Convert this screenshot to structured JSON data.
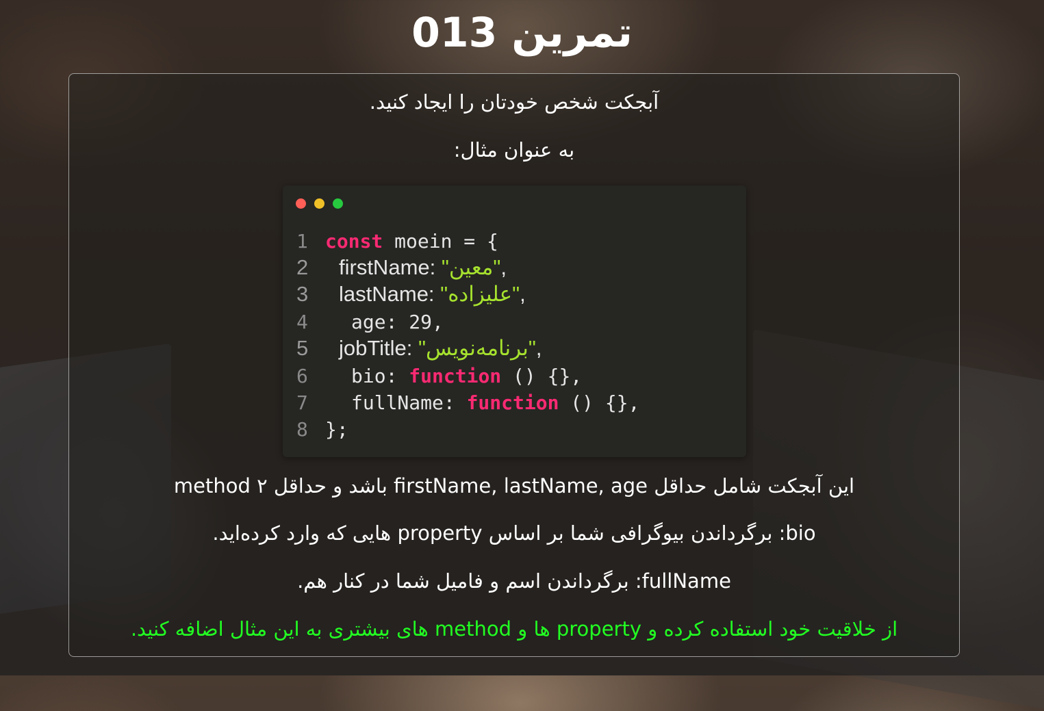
{
  "title": "تمرین 013",
  "card": {
    "intro": "آبجکت شخص خودتان را ایجاد کنید.",
    "example_label": "به عنوان مثال:",
    "requirement": "این آبجکت شامل حداقل firstName, lastName, age باشد و حداقل ۲ method",
    "bio_desc": "bio: برگرداندن بیوگرافی شما بر اساس property هایی که وارد کرده‌اید.",
    "fullname_desc": "fullName: برگرداندن اسم و فامیل شما در کنار هم.",
    "creativity_note": "از خلاقیت خود استفاده کرده و property ها و method های بیشتری به این مثال اضافه کنید."
  },
  "code": {
    "window_buttons": [
      "close",
      "minimize",
      "maximize"
    ],
    "lines": [
      {
        "num": "1",
        "kw": "const",
        "text": " moein = {"
      },
      {
        "num": "2",
        "key": "firstName: ",
        "value": "\"معین\"",
        "tail": ","
      },
      {
        "num": "3",
        "key": "lastName: ",
        "value": "\"علیزاده\"",
        "tail": ","
      },
      {
        "num": "4",
        "text": "age: 29,"
      },
      {
        "num": "5",
        "key": "jobTitle: ",
        "value": "\"برنامه‌نویس\"",
        "tail": ","
      },
      {
        "num": "6",
        "pre": "bio: ",
        "kw": "function",
        "post": " () {},"
      },
      {
        "num": "7",
        "pre": "fullName: ",
        "kw": "function",
        "post": " () {},"
      },
      {
        "num": "8",
        "text": "};"
      }
    ]
  },
  "colors": {
    "keyword": "#f92a72",
    "string": "#a6e22e",
    "note": "#22ff22",
    "code_bg": "#262623"
  }
}
